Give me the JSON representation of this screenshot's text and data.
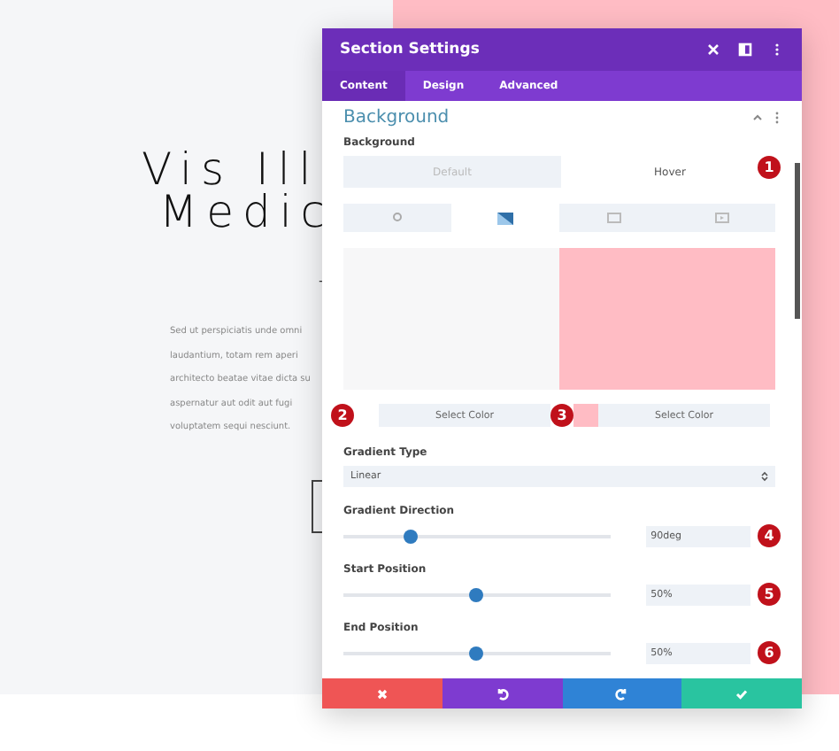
{
  "page": {
    "heading_lines": [
      "Vis Ill",
      "Medic"
    ],
    "dash": "-",
    "paragraph_lines": [
      "Sed ut perspiciatis unde omni",
      "laudantium, totam rem aperi",
      "architecto beatae vitae dicta su",
      "aspernatur aut odit aut fugi",
      "voluptatem sequi nesciunt."
    ]
  },
  "modal": {
    "title": "Section Settings",
    "tabs": [
      {
        "label": "Content",
        "selected": true
      },
      {
        "label": "Design",
        "selected": false
      },
      {
        "label": "Advanced",
        "selected": false
      }
    ],
    "section_title": "Background",
    "background_label": "Background",
    "state_toggle": [
      {
        "label": "Default",
        "selected": false
      },
      {
        "label": "Hover",
        "selected": true
      }
    ],
    "type_tabs": [
      {
        "kind": "color",
        "selected": false
      },
      {
        "kind": "gradient",
        "selected": true
      },
      {
        "kind": "image",
        "selected": false
      },
      {
        "kind": "video",
        "selected": false
      }
    ],
    "color_pickers": [
      {
        "badge": "2",
        "label": "Select Color"
      },
      {
        "badge": "3",
        "label": "Select Color",
        "color": "#ffbcc4"
      }
    ],
    "toggle_badge": "1",
    "gradient_type": {
      "label": "Gradient Type",
      "value": "Linear"
    },
    "sliders": [
      {
        "label": "Gradient Direction",
        "level": 0.25,
        "value": "90deg",
        "badge": "4"
      },
      {
        "label": "Start Position",
        "level": 0.5,
        "value": "50%",
        "badge": "5"
      },
      {
        "label": "End Position",
        "level": 0.5,
        "value": "50%",
        "badge": "6"
      }
    ],
    "footer": [
      {
        "kind": "cancel"
      },
      {
        "kind": "undo"
      },
      {
        "kind": "redo"
      },
      {
        "kind": "save"
      }
    ]
  }
}
